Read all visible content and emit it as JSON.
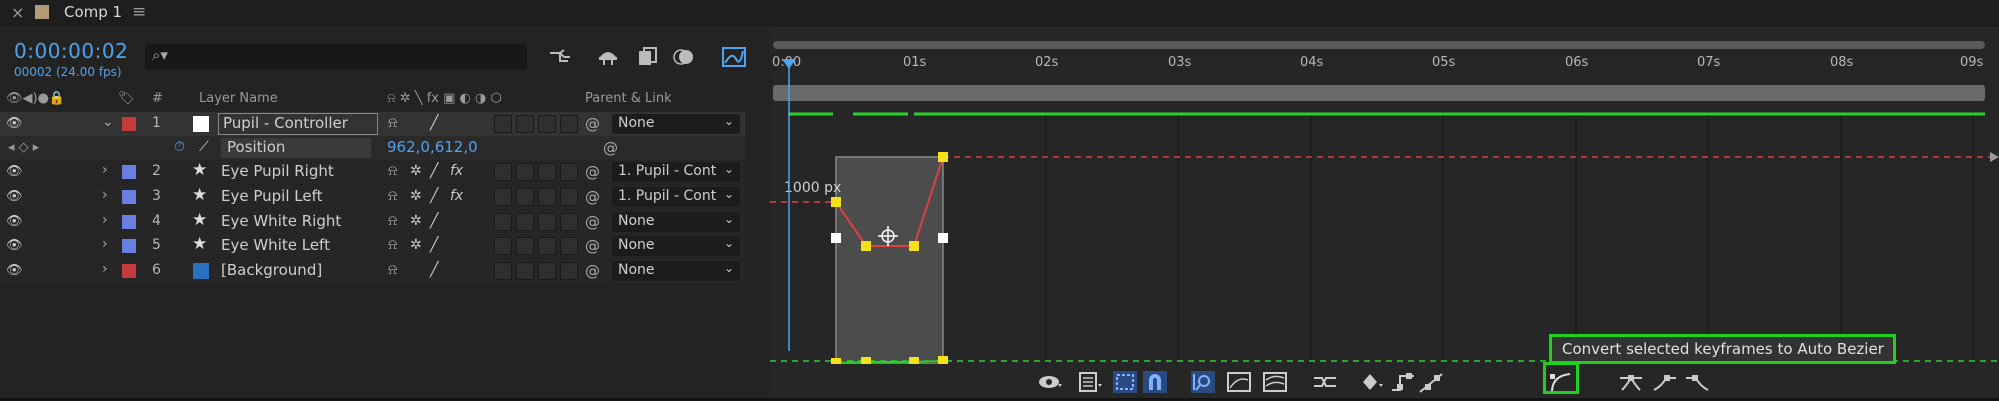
{
  "tab": {
    "close": "×",
    "title": "Comp 1",
    "menu": "≡",
    "swatch_color": "#b09a78"
  },
  "header": {
    "timecode": "0:00:00:02",
    "fps": "00002 (24.00 fps)",
    "search_glyph": "⌕▾"
  },
  "columns": {
    "layer_name": "Layer Name",
    "parent_link": "Parent & Link",
    "hash": "#"
  },
  "layers": [
    {
      "num": "1",
      "name": "Pupil - Controller",
      "color": "#c43b3b",
      "type": "solid-white",
      "parent": "None",
      "fx": false,
      "selected": true
    },
    {
      "num": "2",
      "name": "Eye Pupil Right",
      "color": "#6b7fe0",
      "type": "shape",
      "parent": "1. Pupil - Cont",
      "fx": true
    },
    {
      "num": "3",
      "name": "Eye Pupil Left",
      "color": "#6b7fe0",
      "type": "shape",
      "parent": "1. Pupil - Cont",
      "fx": true
    },
    {
      "num": "4",
      "name": "Eye White Right",
      "color": "#6b7fe0",
      "type": "shape",
      "parent": "None",
      "fx": false
    },
    {
      "num": "5",
      "name": "Eye White Left",
      "color": "#6b7fe0",
      "type": "shape",
      "parent": "None",
      "fx": false
    },
    {
      "num": "6",
      "name": "[Background]",
      "color": "#c43b3b",
      "type": "solid-blue",
      "parent": "None",
      "fx": false
    }
  ],
  "property": {
    "name": "Position",
    "value": "962,0,612,0"
  },
  "ruler": {
    "labels": [
      "0:00",
      "01s",
      "02s",
      "03s",
      "04s",
      "05s",
      "06s",
      "07s",
      "08s",
      "09s"
    ]
  },
  "graph": {
    "label": "1000 px"
  },
  "tooltip": {
    "text": "Convert selected keyframes to Auto Bezier"
  },
  "colors": {
    "accent_blue": "#4ea3f0",
    "highlight_green": "#1fd01f",
    "keyframe_yellow": "#f5e11a",
    "curve_red": "#e04040",
    "velocity_green": "#2ad12a"
  }
}
